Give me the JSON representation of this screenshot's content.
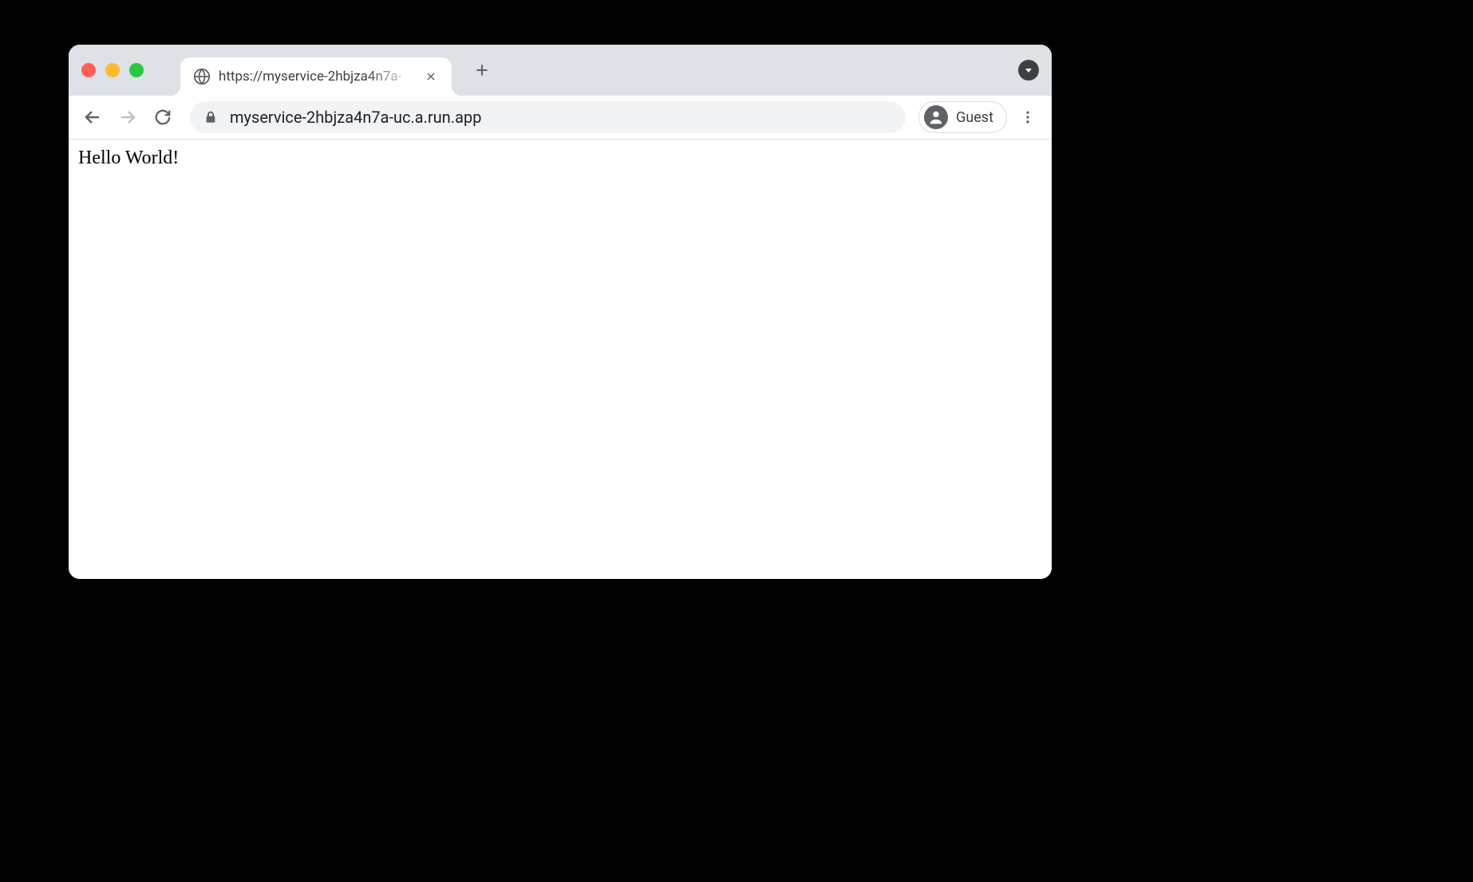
{
  "tab": {
    "title": "https://myservice-2hbjza4n7a-"
  },
  "address_bar": {
    "url": "myservice-2hbjza4n7a-uc.a.run.app"
  },
  "profile": {
    "label": "Guest"
  },
  "page": {
    "body_text": "Hello World!"
  }
}
